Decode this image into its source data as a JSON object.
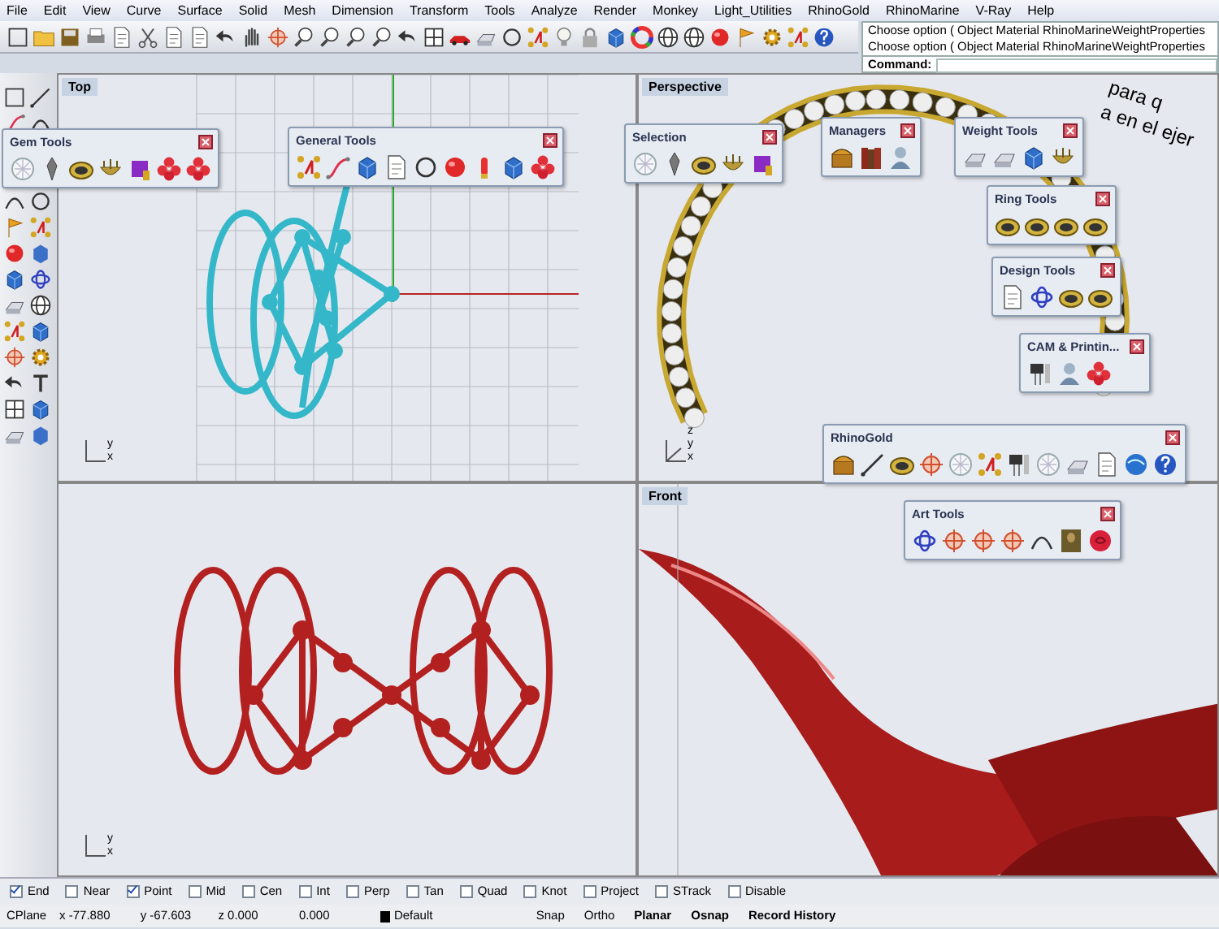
{
  "menu": [
    "File",
    "Edit",
    "View",
    "Curve",
    "Surface",
    "Solid",
    "Mesh",
    "Dimension",
    "Transform",
    "Tools",
    "Analyze",
    "Render",
    "Monkey",
    "Light_Utilities",
    "RhinoGold",
    "RhinoMarine",
    "V-Ray",
    "Help"
  ],
  "command": {
    "history": [
      "Choose option ( Object  Material  RhinoMarineWeightProperties",
      "Choose option ( Object  Material  RhinoMarineWeightProperties"
    ],
    "label": "Command:"
  },
  "viewports": [
    {
      "title": "Top",
      "axis_labels": [
        "y",
        "x"
      ]
    },
    {
      "title": "Perspective",
      "axis_labels": [
        "z",
        "y",
        "x"
      ],
      "curve_text": [
        "para q",
        "a en el ejer"
      ]
    },
    {
      "axis_labels": [
        "y",
        "x"
      ]
    },
    {
      "title": "Front"
    }
  ],
  "panels": [
    {
      "title": "Gem Tools"
    },
    {
      "title": "General Tools"
    },
    {
      "title": "Selection"
    },
    {
      "title": "Managers"
    },
    {
      "title": "Weight Tools"
    },
    {
      "title": "Ring Tools"
    },
    {
      "title": "Design Tools"
    },
    {
      "title": "CAM & Printin..."
    },
    {
      "title": "RhinoGold"
    },
    {
      "title": "Art Tools"
    }
  ],
  "osnaps": [
    {
      "label": "End",
      "checked": true
    },
    {
      "label": "Near",
      "checked": false
    },
    {
      "label": "Point",
      "checked": true
    },
    {
      "label": "Mid",
      "checked": false
    },
    {
      "label": "Cen",
      "checked": false
    },
    {
      "label": "Int",
      "checked": false
    },
    {
      "label": "Perp",
      "checked": false
    },
    {
      "label": "Tan",
      "checked": false
    },
    {
      "label": "Quad",
      "checked": false
    },
    {
      "label": "Knot",
      "checked": false
    },
    {
      "label": "Project",
      "checked": false
    },
    {
      "label": "STrack",
      "checked": false
    },
    {
      "label": "Disable",
      "checked": false
    }
  ],
  "status": {
    "plane": "CPlane",
    "x": "x -77.880",
    "y": "y -67.603",
    "z": "z 0.000",
    "w": "0.000",
    "layer": "Default",
    "color": "#000000"
  },
  "toggles": [
    {
      "label": "Snap",
      "on": false
    },
    {
      "label": "Ortho",
      "on": false
    },
    {
      "label": "Planar",
      "on": true
    },
    {
      "label": "Osnap",
      "on": true
    },
    {
      "label": "Record History",
      "on": true
    }
  ]
}
